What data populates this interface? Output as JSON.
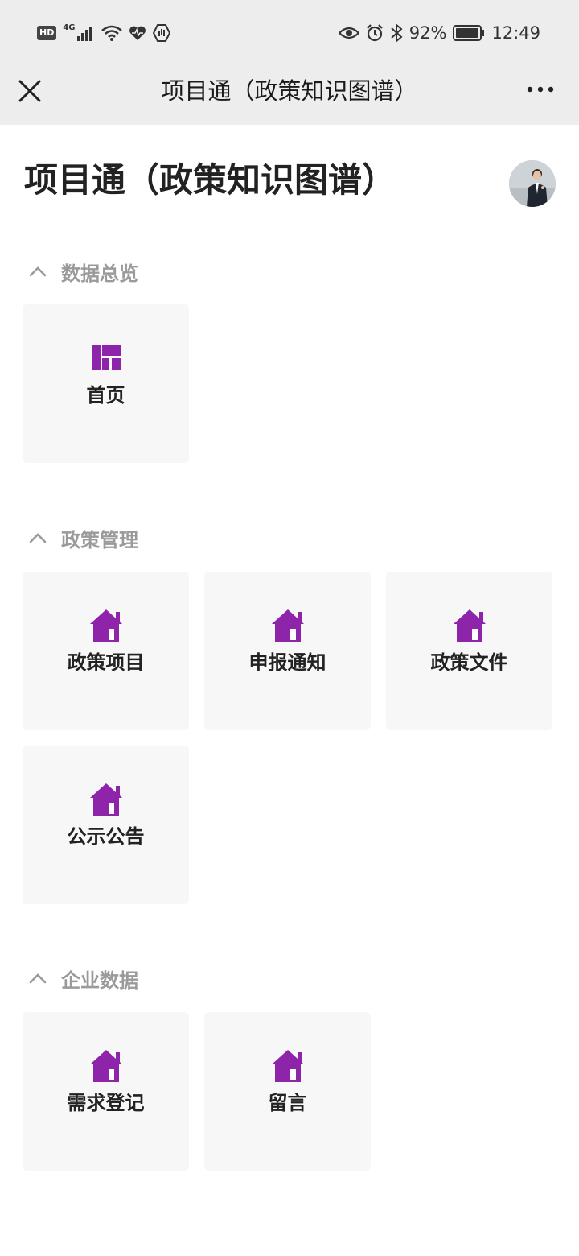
{
  "status_bar": {
    "hd": "HD",
    "network": "4G",
    "battery": "92%",
    "time": "12:49"
  },
  "nav": {
    "title": "项目通（政策知识图谱）"
  },
  "page": {
    "title": "项目通（政策知识图谱）"
  },
  "sections": [
    {
      "label": "数据总览",
      "tiles": [
        {
          "label": "首页",
          "icon": "dashboard-icon"
        }
      ]
    },
    {
      "label": "政策管理",
      "tiles": [
        {
          "label": "政策项目",
          "icon": "home-icon"
        },
        {
          "label": "申报通知",
          "icon": "home-icon"
        },
        {
          "label": "政策文件",
          "icon": "home-icon"
        },
        {
          "label": "公示公告",
          "icon": "home-icon"
        }
      ]
    },
    {
      "label": "企业数据",
      "tiles": [
        {
          "label": "需求登记",
          "icon": "home-icon"
        },
        {
          "label": "留言",
          "icon": "home-icon"
        }
      ]
    }
  ],
  "colors": {
    "accent": "#8e24aa",
    "bar_bg": "#ededed",
    "tile_bg": "#f7f7f7",
    "section_label": "#9a9a9a"
  }
}
